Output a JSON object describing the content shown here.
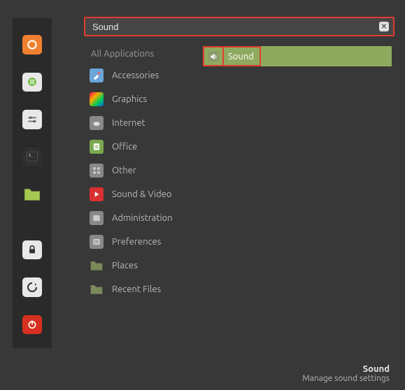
{
  "sidebar": {
    "items": [
      {
        "name": "firefox"
      },
      {
        "name": "apps"
      },
      {
        "name": "settings"
      },
      {
        "name": "terminal"
      },
      {
        "name": "files"
      },
      {
        "name": "lock"
      },
      {
        "name": "logout"
      },
      {
        "name": "power"
      }
    ]
  },
  "search": {
    "value": "Sound"
  },
  "all_applications_label": "All Applications",
  "categories": [
    {
      "label": "Accessories",
      "icon": "accessories"
    },
    {
      "label": "Graphics",
      "icon": "graphics"
    },
    {
      "label": "Internet",
      "icon": "internet"
    },
    {
      "label": "Office",
      "icon": "office"
    },
    {
      "label": "Other",
      "icon": "other"
    },
    {
      "label": "Sound & Video",
      "icon": "sound-video"
    },
    {
      "label": "Administration",
      "icon": "administration"
    },
    {
      "label": "Preferences",
      "icon": "preferences"
    },
    {
      "label": "Places",
      "icon": "places"
    },
    {
      "label": "Recent Files",
      "icon": "recent-files"
    }
  ],
  "results": [
    {
      "label": "Sound",
      "icon": "sound",
      "selected": true
    }
  ],
  "tooltip": {
    "title": "Sound",
    "description": "Manage sound settings"
  },
  "colors": {
    "highlight_red": "#e23c2f",
    "selection_green": "#8faa5f",
    "background": "#383838"
  }
}
